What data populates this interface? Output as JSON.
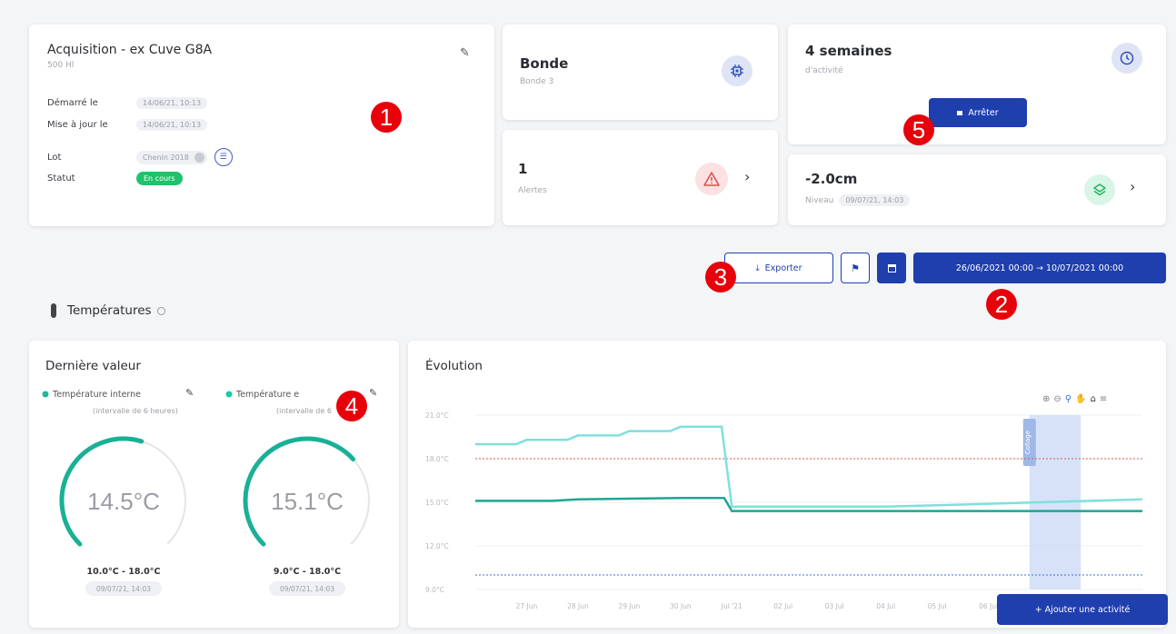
{
  "acquisition": {
    "title": "Acquisition - ex Cuve G8A",
    "subtitle": "500 Hl",
    "rows": [
      {
        "label": "Démarré le",
        "value": "14/06/21, 10:13"
      },
      {
        "label": "Mise à jour le",
        "value": "14/06/21, 10:13"
      },
      {
        "label": "Lot",
        "value": "Chenin 2018"
      },
      {
        "label": "Statut",
        "value": "En cours"
      }
    ]
  },
  "bonde": {
    "title": "Bonde",
    "subtitle": "Bonde 3"
  },
  "alerts": {
    "count": "1",
    "label": "Alertes"
  },
  "activity": {
    "title": "4 semaines",
    "subtitle": "d'activité",
    "stop_label": "Arrêter"
  },
  "level": {
    "value": "-2.0cm",
    "label": "Niveau",
    "timestamp": "09/07/21, 14:03"
  },
  "toolbar": {
    "export_label": "Exporter",
    "date_range": "26/06/2021 00:00 → 10/07/2021 00:00"
  },
  "section": {
    "title": "Températures"
  },
  "last_value": {
    "title": "Dernière valeur",
    "gauges": [
      {
        "name": "Température interne",
        "interval": "(intervalle de 6 heures)",
        "value": "14.5°C",
        "range": "10.0°C - 18.0°C",
        "timestamp": "09/07/21, 14:03",
        "color": "#1fb79a",
        "fill": 0.5625
      },
      {
        "name": "Température e",
        "interval": "(intervalle de 6",
        "value": "15.1°C",
        "range": "9.0°C - 18.0°C",
        "timestamp": "09/07/21, 14:03",
        "color": "#19c9a8",
        "fill": 0.678
      }
    ]
  },
  "evolution": {
    "title": "Évolution",
    "add_activity_label": "+ Ajouter une activité",
    "band_label": "Collage",
    "chart_data": {
      "type": "line",
      "y_ticks": [
        "21.0°C",
        "18.0°C",
        "15.0°C",
        "12.0°C",
        "9.0°C"
      ],
      "x_ticks": [
        "27 Jun",
        "28 Jun",
        "29 Jun",
        "30 Jun",
        "Jul '21",
        "02 Jul",
        "03 Jul",
        "04 Jul",
        "05 Jul",
        "06 Jul"
      ],
      "ylim": [
        9,
        21
      ],
      "xlim": [
        0,
        13
      ],
      "thresholds": [
        {
          "value": 18,
          "color": "#e05a4f"
        },
        {
          "value": 10,
          "color": "#3d6fd8"
        }
      ],
      "band": {
        "from": 10.8,
        "to": 11.8
      },
      "series": [
        {
          "color": "#7fe0dc",
          "points": [
            [
              0,
              19
            ],
            [
              0.8,
              19
            ],
            [
              1,
              19.3
            ],
            [
              1.8,
              19.3
            ],
            [
              2,
              19.6
            ],
            [
              2.8,
              19.6
            ],
            [
              3,
              19.9
            ],
            [
              3.8,
              19.9
            ],
            [
              4,
              20.2
            ],
            [
              4.8,
              20.2
            ],
            [
              5,
              14.7
            ],
            [
              8,
              14.7
            ],
            [
              9,
              14.8
            ],
            [
              13,
              15.2
            ]
          ]
        },
        {
          "color": "#1ea593",
          "points": [
            [
              0,
              15.1
            ],
            [
              1.5,
              15.1
            ],
            [
              2,
              15.2
            ],
            [
              4,
              15.3
            ],
            [
              4.85,
              15.3
            ],
            [
              5,
              14.4
            ],
            [
              13,
              14.4
            ]
          ]
        }
      ]
    }
  }
}
